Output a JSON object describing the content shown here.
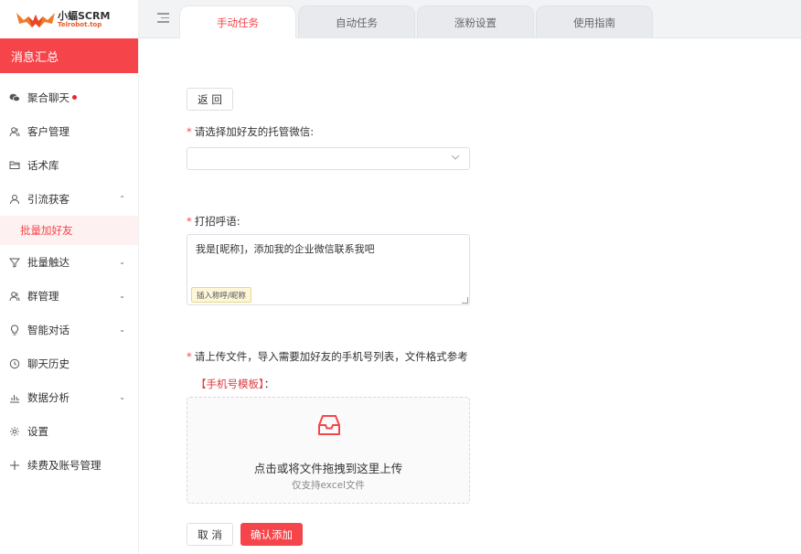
{
  "brand": {
    "name": "小蝠SCRM",
    "domain": "Telrobot.top",
    "accent": "#f5454b"
  },
  "sidebar": {
    "section_title": "消息汇总",
    "items": [
      {
        "label": "聚合聊天",
        "icon": "wechat-icon",
        "has_dot": true
      },
      {
        "label": "客户管理",
        "icon": "users-icon"
      },
      {
        "label": "话术库",
        "icon": "folder-icon"
      },
      {
        "label": "引流获客",
        "icon": "user-icon",
        "expanded": true
      },
      {
        "label": "批量加好友",
        "sub": true,
        "active": true
      },
      {
        "label": "批量触达",
        "icon": "filter-icon",
        "expandable": true
      },
      {
        "label": "群管理",
        "icon": "group-icon",
        "expandable": true
      },
      {
        "label": "智能对话",
        "icon": "bulb-icon",
        "expandable": true
      },
      {
        "label": "聊天历史",
        "icon": "history-icon"
      },
      {
        "label": "数据分析",
        "icon": "chart-icon",
        "expandable": true
      },
      {
        "label": "设置",
        "icon": "gear-icon"
      },
      {
        "label": "续费及账号管理",
        "icon": "plus-icon"
      }
    ]
  },
  "tabs": [
    {
      "label": "手动任务",
      "active": true
    },
    {
      "label": "自动任务"
    },
    {
      "label": "涨粉设置"
    },
    {
      "label": "使用指南"
    }
  ],
  "form": {
    "back_label": "返 回",
    "wechat_label": "请选择加好友的托管微信:",
    "wechat_value": "",
    "greeting_label": "打招呼语:",
    "greeting_value": "我是[昵称]，添加我的企业微信联系我吧",
    "insert_tag": "插入称呼/昵称",
    "upload_label": "请上传文件，导入需要加好友的手机号列表，文件格式参考",
    "template_link": "【手机号模板】",
    "template_colon": "：",
    "upload_title": "点击或将文件拖拽到这里上传",
    "upload_hint": "仅支持excel文件",
    "cancel_label": "取 消",
    "confirm_label": "确认添加"
  }
}
